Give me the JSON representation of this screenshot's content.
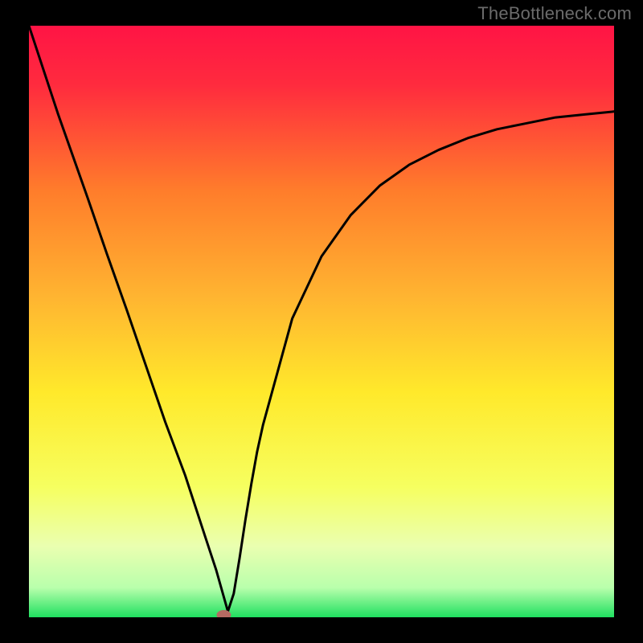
{
  "watermark": "TheBottleneck.com",
  "chart_data": {
    "type": "line",
    "title": "",
    "xlabel": "",
    "ylabel": "",
    "xlim": [
      0,
      10
    ],
    "ylim": [
      0,
      100
    ],
    "grid": false,
    "legend": false,
    "colors": {
      "gradient_top": "#ff1445",
      "gradient_upper_mid": "#ff7d2b",
      "gradient_mid": "#ffe92b",
      "gradient_lower_mid": "#f6ff60",
      "gradient_bottom": "#1fe060",
      "curve": "#000000",
      "marker_fill": "#b56a62",
      "marker_border": "#b56a62"
    },
    "x": [
      0.0,
      0.5,
      1.0,
      1.33,
      1.67,
      2.0,
      2.33,
      2.67,
      3.0,
      3.1,
      3.2,
      3.3,
      3.4,
      3.5,
      3.6,
      3.7,
      3.8,
      3.9,
      4.0,
      4.5,
      5.0,
      5.5,
      6.0,
      6.5,
      7.0,
      7.5,
      8.0,
      8.5,
      9.0,
      9.5,
      10.0
    ],
    "values": [
      100.0,
      85.0,
      71.0,
      61.5,
      52.0,
      42.5,
      33.0,
      24.0,
      14.0,
      11.0,
      8.0,
      4.5,
      1.0,
      4.0,
      10.0,
      16.5,
      22.5,
      28.0,
      32.5,
      50.5,
      61.0,
      68.0,
      73.0,
      76.5,
      79.0,
      81.0,
      82.5,
      83.5,
      84.5,
      85.0,
      85.5
    ],
    "marker": {
      "x": 3.33,
      "y": 0.4
    }
  }
}
